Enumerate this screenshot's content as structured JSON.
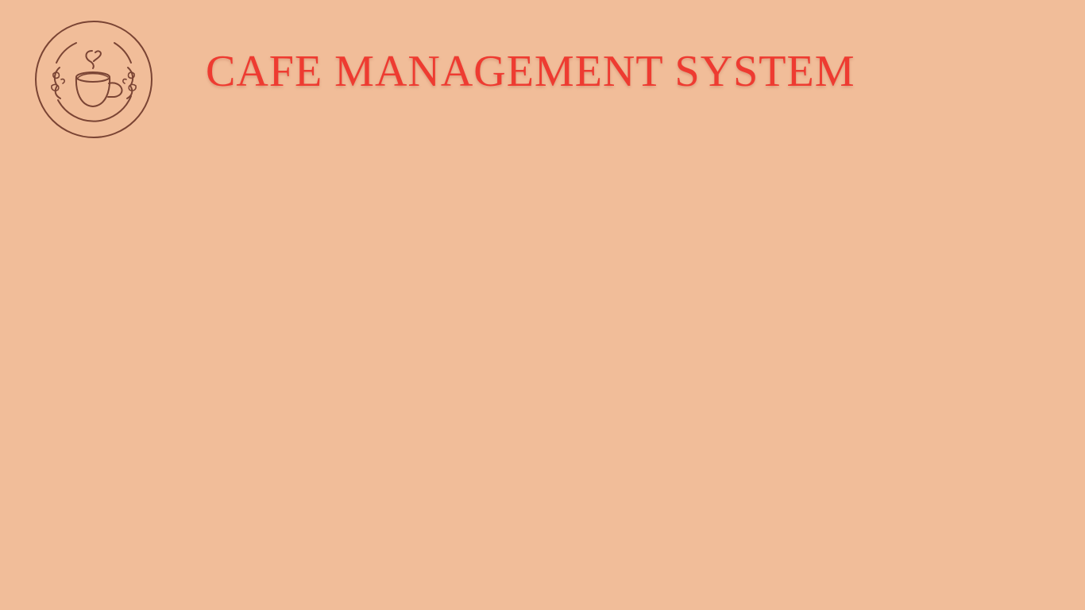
{
  "app": {
    "title": "CAFE MANAGEMENT SYSTEM"
  },
  "logo": {
    "icon": "coffee-cup-icon"
  },
  "colors": {
    "background": "#f1bd99",
    "title": "#ee3b31",
    "logo_stroke": "#7a4434"
  }
}
